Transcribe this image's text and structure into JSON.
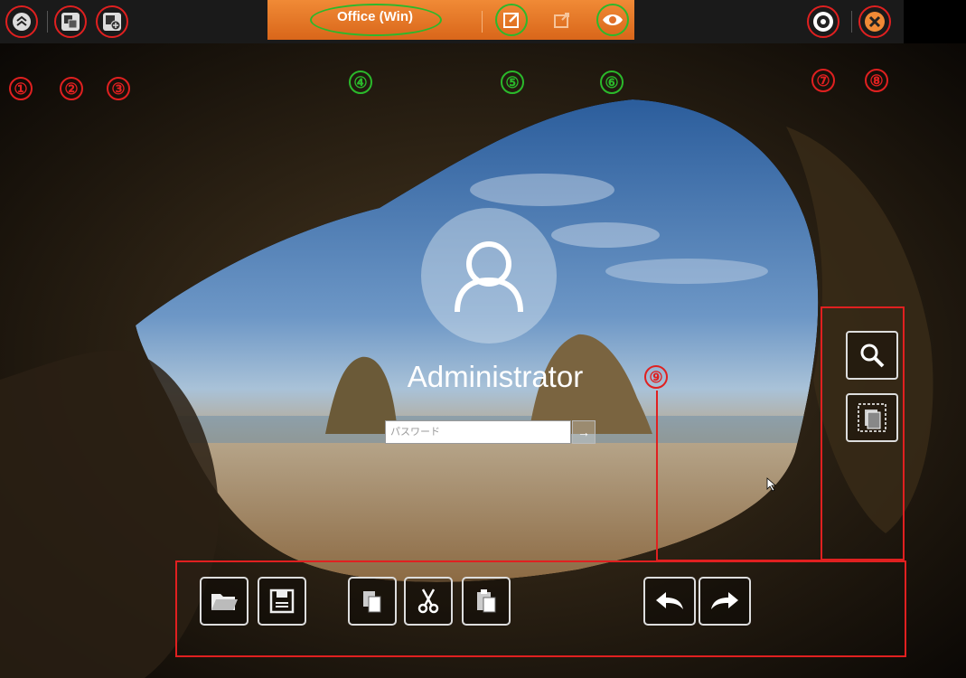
{
  "topbar": {
    "title": "Office (Win)",
    "icons": [
      "collapse-icon",
      "switch-monitor-icon",
      "add-window-icon",
      "edit-icon",
      "share-icon",
      "view-icon",
      "settings-icon",
      "close-icon"
    ]
  },
  "login": {
    "username": "Administrator",
    "password_placeholder": "パスワード",
    "submit_glyph": "→"
  },
  "callouts": {
    "n1": "①",
    "n2": "②",
    "n3": "③",
    "n4": "④",
    "n5": "⑤",
    "n6": "⑥",
    "n7": "⑦",
    "n8": "⑧",
    "n9": "⑨"
  },
  "toolbar": {
    "tools": [
      "open-folder-icon",
      "save-icon",
      "copy-icon",
      "cut-icon",
      "paste-icon",
      "undo-icon",
      "redo-icon"
    ],
    "side_tools": [
      "zoom-icon",
      "select-area-icon"
    ]
  },
  "colors": {
    "accent_orange": "#e8792a",
    "callout_red": "#e02020",
    "callout_green": "#2bb92b"
  }
}
